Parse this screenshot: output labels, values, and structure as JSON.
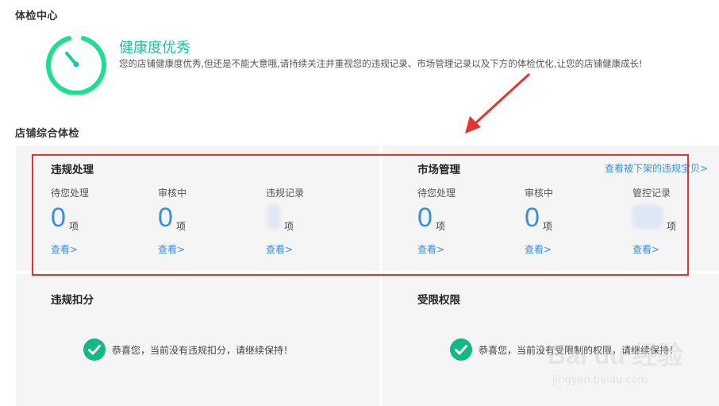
{
  "sections": {
    "checkup_center": "体检中心",
    "store_checkup": "店铺综合体检"
  },
  "health": {
    "status": "健康度优秀",
    "description": "您的店铺健康度优秀,但还是不能大意哦,请持续关注并重视您的违规记录、市场管理记录以及下方的体检优化,让您的店铺健康成长!",
    "accent_color": "#1dc6a2",
    "icon": "gauge-icon"
  },
  "violation": {
    "title": "违规处理",
    "stats": [
      {
        "label": "待您处理",
        "value": "0",
        "unit": "项",
        "link": "查看>"
      },
      {
        "label": "审核中",
        "value": "0",
        "unit": "项",
        "link": "查看>"
      },
      {
        "label": "违规记录",
        "value": "",
        "unit": "项",
        "link": "查看>"
      }
    ]
  },
  "market": {
    "title": "市场管理",
    "top_link": "查看被下架的违规宝贝>",
    "stats": [
      {
        "label": "待您处理",
        "value": "0",
        "unit": "项",
        "link": "查看>"
      },
      {
        "label": "审核中",
        "value": "0",
        "unit": "项",
        "link": "查看>"
      },
      {
        "label": "管控记录",
        "value": "",
        "unit": "项",
        "link": "查看>"
      }
    ]
  },
  "deduction": {
    "title": "违规扣分",
    "message": "恭喜您，当前没有违规扣分，请继续保持！",
    "icon": "check-circle-icon"
  },
  "restriction": {
    "title": "受限权限",
    "message": "恭喜您，当前没有受限制的权限，请继续保持！",
    "icon": "check-circle-icon"
  },
  "watermark": {
    "main": "Bai du 经验",
    "sub": "jingyan.baidu.com"
  },
  "colors": {
    "link": "#3b8fe0",
    "highlight_box": "#e8322f",
    "success": "#12b886"
  }
}
